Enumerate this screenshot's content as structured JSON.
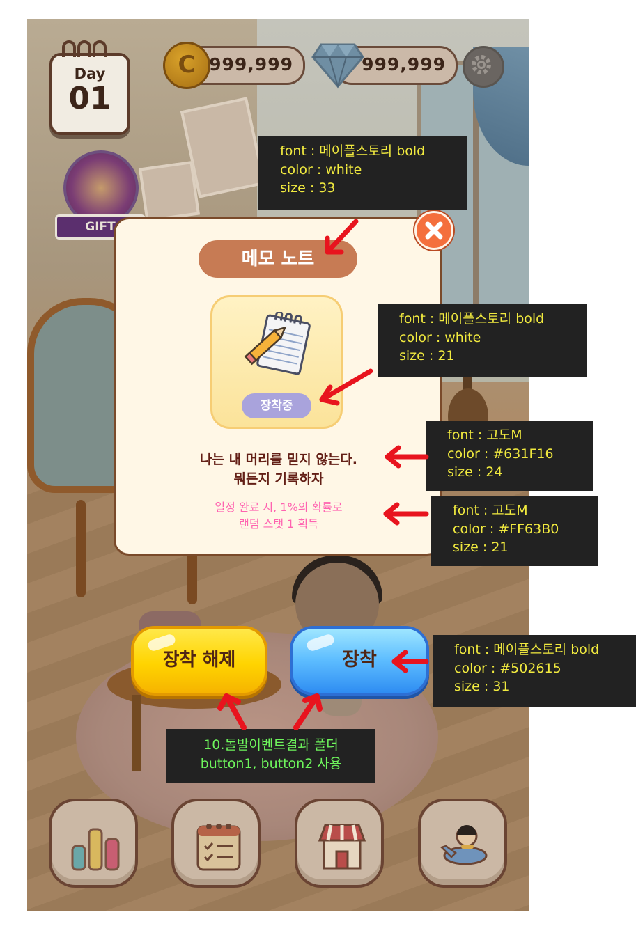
{
  "hud": {
    "calendar_label": "Day",
    "calendar_day": "01",
    "coins": "999,999",
    "coin_symbol": "C",
    "gems": "999,999",
    "gift_label": "GIFT"
  },
  "modal": {
    "title": "메모 노트",
    "item_status": "장착중",
    "description_line1": "나는 내 머리를 믿지 않는다.",
    "description_line2": "뭐든지 기록하자",
    "effect_line1": "일정 완료 시, 1%의 확률로",
    "effect_line2": "랜덤 스탯 1 획득"
  },
  "buttons": {
    "unequip_label": "장착 해제",
    "equip_label": "장착"
  },
  "nav": {
    "items": [
      "stats-icon",
      "schedule-icon",
      "shop-icon",
      "travel-icon"
    ]
  },
  "annotations": {
    "title_note": [
      "font : 메이플스토리 bold",
      "color : white",
      "size : 33"
    ],
    "tag_note": [
      "font : 메이플스토리 bold",
      "color : white",
      "size : 21"
    ],
    "desc_note": [
      "font : 고도M",
      "color : #631F16",
      "size : 24"
    ],
    "effect_note": [
      "font : 고도M",
      "color : #FF63B0",
      "size : 21"
    ],
    "button_note": [
      "font : 메이플스토리 bold",
      "color : #502615",
      "size : 31"
    ],
    "folder_note": [
      "10.돌발이벤트결과 폴더",
      "button1, button2 사용"
    ]
  },
  "colors": {
    "annotation_text": "#f1ea3f",
    "annotation_green": "#6ef55c",
    "arrow": "#e8141e",
    "desc": "#631F16",
    "effect": "#FF63B0",
    "button_text": "#502615"
  }
}
